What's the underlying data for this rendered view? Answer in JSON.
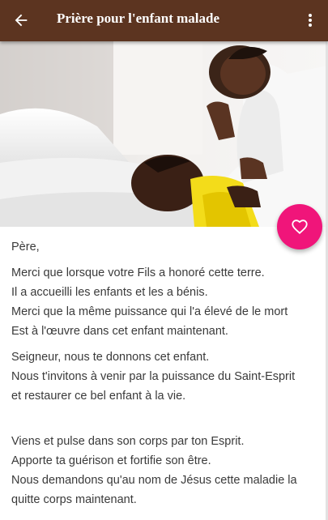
{
  "app_bar": {
    "title": "Prière pour l'enfant malade",
    "back_icon": "arrow-back-icon",
    "menu_icon": "more-vertical-icon",
    "background_color": "#5c3420"
  },
  "hero_image": {
    "subject": "woman praying beside sleeping child"
  },
  "favorite_button": {
    "icon": "heart-outline-icon",
    "color": "#f0157a"
  },
  "prayer": {
    "salutation": "Père,",
    "stanza1": [
      "Merci que lorsque votre Fils a honoré cette terre.",
      "Il a accueilli les enfants et les a bénis.",
      "Merci que la même puissance qui l'a élevé de le mort",
      "Est à l'œuvre dans cet enfant maintenant."
    ],
    "stanza2": [
      "Seigneur, nous te donnons cet enfant.",
      "Nous t'invitons à venir par la puissance du Saint-Esprit",
      "et restaurer ce bel enfant à la vie."
    ],
    "stanza3": [
      "Viens et pulse dans son corps par ton Esprit.",
      "Apporte ta guérison et fortifie son être.",
      "Nous demandons qu'au nom de Jésus cette maladie la",
      "quitte corps maintenant."
    ]
  }
}
